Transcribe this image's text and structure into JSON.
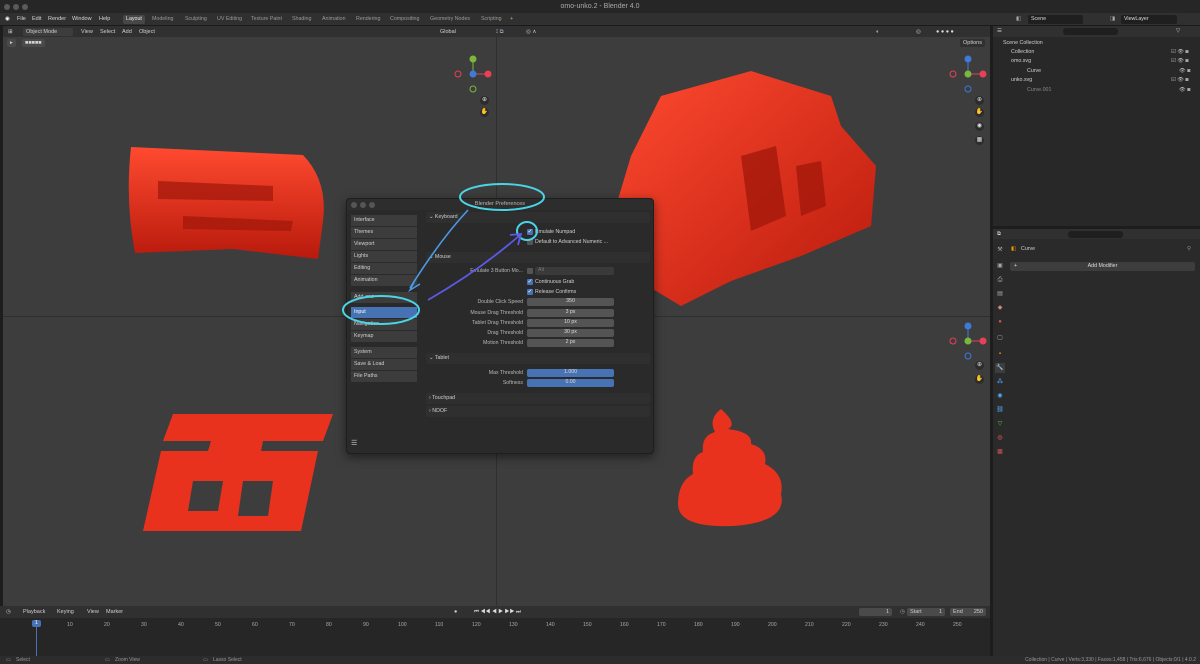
{
  "window": {
    "title": "omo-unko.2 - Blender 4.0"
  },
  "menu": {
    "items": [
      "File",
      "Edit",
      "Render",
      "Window",
      "Help"
    ],
    "workspaces": [
      "Layout",
      "Modeling",
      "Sculpting",
      "UV Editing",
      "Texture Paint",
      "Shading",
      "Animation",
      "Rendering",
      "Compositing",
      "Geometry Nodes",
      "Scripting"
    ],
    "active_workspace": "Layout",
    "scene": "Scene",
    "view_layer": "ViewLayer"
  },
  "viewport": {
    "mode": "Object Mode",
    "menus": [
      "View",
      "Select",
      "Add",
      "Object"
    ],
    "transform": "Global",
    "options": "Options",
    "gizmo_axes": {
      "x": "X",
      "y": "Y",
      "z": "Z"
    }
  },
  "prefs": {
    "title": "Blender Preferences",
    "categories": [
      "Interface",
      "Themes",
      "Viewport",
      "Lights",
      "Editing",
      "Animation",
      "Add-ons",
      "Input",
      "Navigation",
      "Keymap",
      "System",
      "Save & Load",
      "File Paths"
    ],
    "selected": "Input",
    "keyboard": {
      "label": "Keyboard",
      "emulate_numpad": "Emulate Numpad",
      "default_adv": "Default to Advanced Numeric ..."
    },
    "mouse": {
      "label": "Mouse",
      "emulate3_label": "Emulate 3 Button Mo...",
      "emulate3_value": "Alt",
      "continuous_grab": "Continuous Grab",
      "release_confirms": "Release Confirms",
      "rows": [
        {
          "label": "Double Click Speed",
          "value": "350"
        },
        {
          "label": "Mouse Drag Threshold",
          "value": "3 px"
        },
        {
          "label": "Tablet Drag Threshold",
          "value": "10 px"
        },
        {
          "label": "Drag Threshold",
          "value": "30 px"
        },
        {
          "label": "Motion Threshold",
          "value": "2 px"
        }
      ]
    },
    "tablet": {
      "label": "Tablet",
      "max_label": "Max Threshold",
      "max_value": "1.000",
      "soft_label": "Softness",
      "soft_value": "0.00"
    },
    "touchpad": "Touchpad",
    "ndof": "NDOF"
  },
  "outliner": {
    "title": "Scene Collection",
    "items": [
      {
        "name": "Collection"
      },
      {
        "name": "omo.svg"
      },
      {
        "name": "Curve"
      },
      {
        "name": "unko.svg"
      },
      {
        "name": "Curve.001"
      }
    ]
  },
  "properties": {
    "object": "Curve",
    "add_modifier": "Add Modifier"
  },
  "timeline": {
    "menus": [
      "Playback",
      "Keying",
      "View",
      "Marker"
    ],
    "current_frame": "1",
    "start_label": "Start",
    "start": "1",
    "end_label": "End",
    "end": "250",
    "ticks": [
      "10",
      "20",
      "30",
      "40",
      "50",
      "60",
      "70",
      "80",
      "90",
      "100",
      "110",
      "120",
      "130",
      "140",
      "150",
      "160",
      "170",
      "180",
      "190",
      "200",
      "210",
      "220",
      "230",
      "240",
      "250"
    ],
    "marker": "1"
  },
  "status": {
    "left": [
      "Select",
      "Zoom View",
      "Lasso Select"
    ],
    "right": "Collection | Curve | Verts:3,330 | Faces:1,458 | Tris:6,676 | Objects:0/1 | 4.0.2"
  },
  "colors": {
    "accent": "#4772b3",
    "object": "#e8321e",
    "annotation": "#4ad4e6",
    "arrow": "#5a5ae6"
  }
}
